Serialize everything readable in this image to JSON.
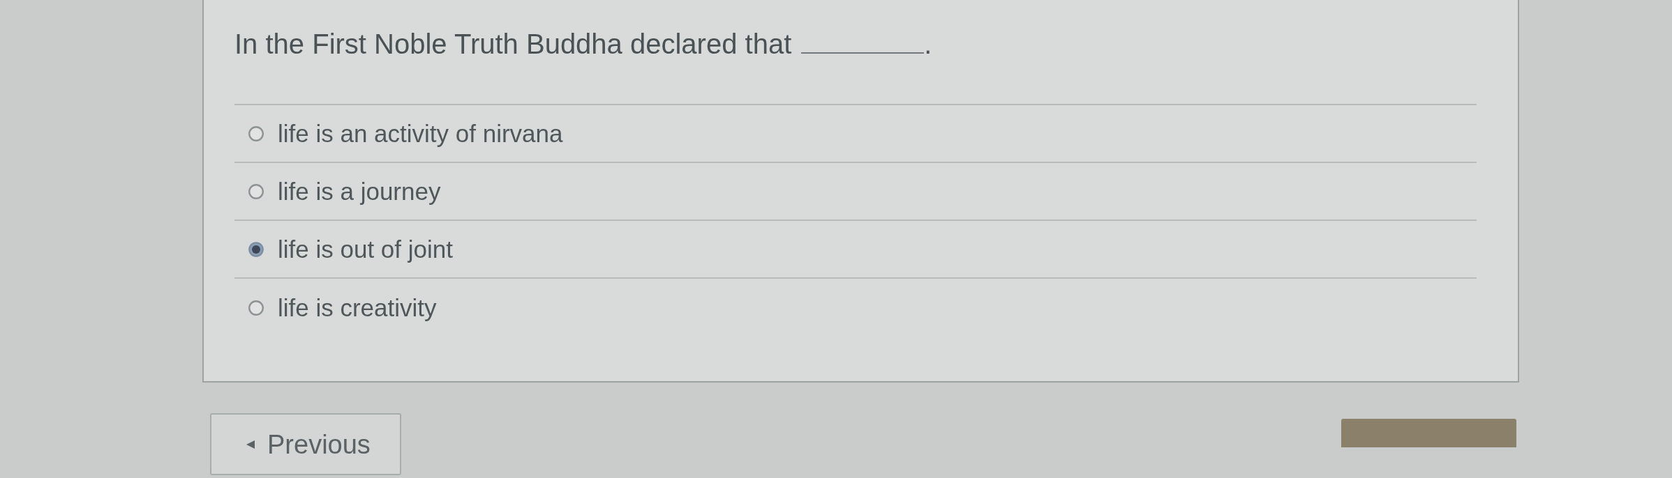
{
  "question": {
    "prompt": "In the First Noble Truth Buddha declared that",
    "blank_end": "."
  },
  "options": [
    {
      "label": "life is an activity of nirvana",
      "selected": false
    },
    {
      "label": "life is a journey",
      "selected": false
    },
    {
      "label": "life is out of joint",
      "selected": true
    },
    {
      "label": "life is creativity",
      "selected": false
    }
  ],
  "navigation": [
    {
      "kind": "secondary",
      "label": "Previous"
    },
    {
      "kind": "primary"
    }
  ]
}
